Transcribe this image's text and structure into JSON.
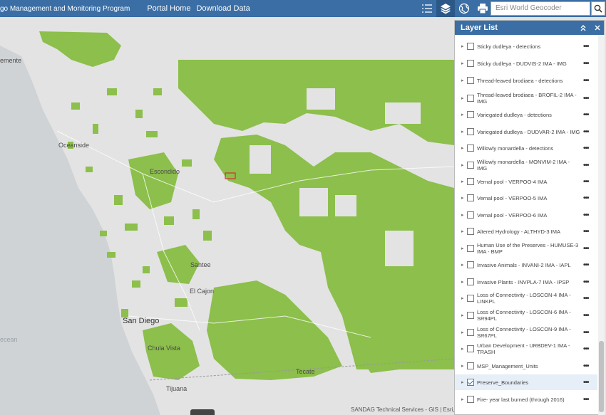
{
  "header": {
    "title": "go Management and Monitoring Program",
    "links": [
      "Portal Home",
      "Download Data"
    ],
    "search_placeholder": "Esri World Geocoder"
  },
  "icons": [
    "list-icon",
    "layers-icon",
    "basemap-gallery-icon",
    "print-icon",
    "search-icon"
  ],
  "map": {
    "places": [
      "emente",
      "Oceanside",
      "Escondido",
      "Santee",
      "El Cajon",
      "San Diego",
      "Chula Vista",
      "Tijuana",
      "Tecate",
      "ecean"
    ],
    "attribution": "SANDAG Technical Services - GIS | Esri, H",
    "preserve_color": "#8cbf4b",
    "land_color": "#e3e3e3",
    "water_color": "#cfd3d6"
  },
  "layer_panel": {
    "title": "Layer List",
    "layers": [
      {
        "label": "Sticky dudleya - detections",
        "checked": false
      },
      {
        "label": "Sticky dudleya - DUDVIS-2 IMA - IMG",
        "checked": false
      },
      {
        "label": "Thread-leaved brodiaea - detections",
        "checked": false
      },
      {
        "label": "Thread-leaved brodiaea - BROFIL-2 IMA - IMG",
        "checked": false
      },
      {
        "label": "Variegated dudleya - detections",
        "checked": false
      },
      {
        "label": "Variegated dudleya - DUDVAR-2 IMA - IMG",
        "checked": false
      },
      {
        "label": "Willowly monardella - detections",
        "checked": false
      },
      {
        "label": "Willowly monardella - MONVIM-2 IMA - IMG",
        "checked": false
      },
      {
        "label": "Vernal pool - VERPOO-4 IMA",
        "checked": false
      },
      {
        "label": "Vernal pool - VERPOO-5 IMA",
        "checked": false
      },
      {
        "label": "Vernal pool - VERPOO-6 IMA",
        "checked": false
      },
      {
        "label": "Altered Hydrology - ALTHYD-3 IMA",
        "checked": false
      },
      {
        "label": "Human Use of the Preserves - HUMUSE-3 IMA - BMP",
        "checked": false
      },
      {
        "label": "Invasive Animals - INVANI-2 IMA - IAPL",
        "checked": false
      },
      {
        "label": "Invasive Plants - INVPLA-7 IMA - IPSP",
        "checked": false
      },
      {
        "label": "Loss of Connectivity - LOSCON-4 IMA - LINKPL",
        "checked": false
      },
      {
        "label": "Loss of Connectivity - LOSCON-6 IMA - SR94PL",
        "checked": false
      },
      {
        "label": "Loss of Connectivity - LOSCON-9 IMA - SR67PL",
        "checked": false
      },
      {
        "label": "Urban Development - URBDEV-1 IMA - TRASH",
        "checked": false
      },
      {
        "label": "MSP_Management_Units",
        "checked": false
      },
      {
        "label": "Preserve_Boundaries",
        "checked": true
      },
      {
        "label": "Fire- year last burned (through 2016)",
        "checked": false
      }
    ]
  }
}
